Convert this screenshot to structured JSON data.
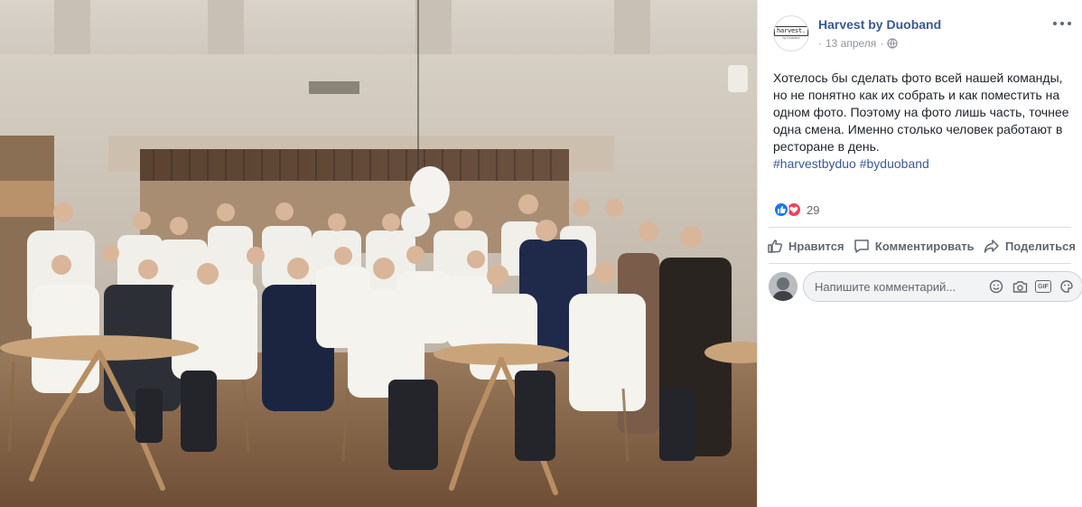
{
  "post": {
    "page_name": "Harvest by Duoband",
    "date": "13 апреля",
    "logo_text": "harvest.",
    "logo_subtext": "by Duoband",
    "text": "Хотелось бы сделать фото всей нашей команды, но не понятно как их собрать и как поместить на одном фото. Поэтому на фото лишь часть, точнее одна смена. Именно столько человек работают в ресторане в день.",
    "hashtags": [
      "#harvestbyduo",
      "#byduoband"
    ],
    "reaction_count": "29",
    "reaction_types": [
      "like-icon",
      "love-icon"
    ]
  },
  "actions": {
    "like": "Нравится",
    "comment": "Комментировать",
    "share": "Поделиться"
  },
  "comment": {
    "placeholder": "Напишите комментарий...",
    "tools": [
      "emoji-icon",
      "camera-icon",
      "gif-icon",
      "sticker-icon"
    ]
  },
  "colors": {
    "link": "#385898",
    "like": "#1877f2",
    "love": "#f33e58",
    "muted": "#606770"
  }
}
